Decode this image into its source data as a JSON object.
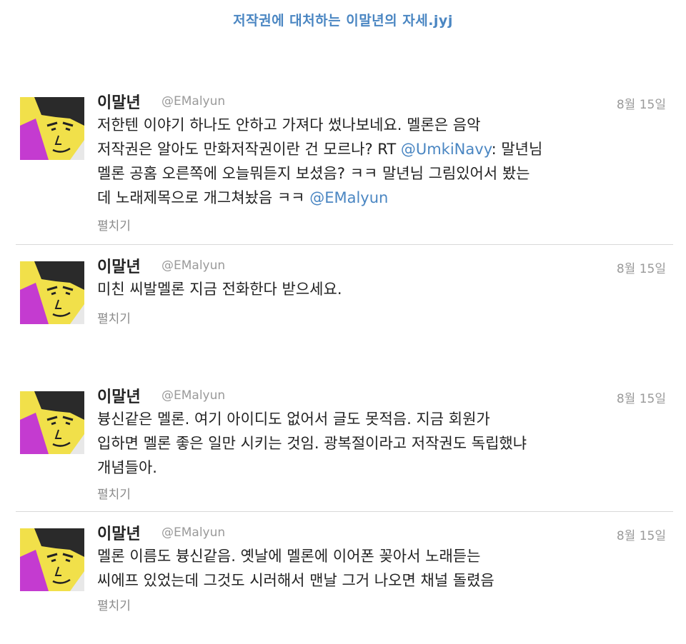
{
  "page_title": "저작권에 대처하는 이말년의 자세.jyj",
  "tweets": [
    {
      "name": "이말년",
      "handle": "@EMalyun",
      "date": "8월 15일",
      "lines": [
        "저한텐 이야기 하나도 안하고 가져다 썼나보네요. 멜론은 음악",
        "저작권은 알아도 만화저작권이란 건 모르나? RT ",
        "@UmkiNavy",
        ": 말년님",
        "멜론 공홈 오른쪽에 오늘뭐듣지 보셨음? ㅋㅋ 말년님 그림있어서 봤는",
        "데 노래제목으로 개그쳐놨음 ㅋㅋ ",
        "@EMalyun"
      ],
      "expand": "펼치기"
    },
    {
      "name": "이말년",
      "handle": "@EMalyun",
      "date": "8월 15일",
      "lines": [
        "미친 씨발멜론 지금 전화한다 받으세요."
      ],
      "expand": "펼치기"
    },
    {
      "name": "이말년",
      "handle": "@EMalyun",
      "date": "8월 15일",
      "lines": [
        "븅신같은 멜론. 여기 아이디도 없어서 글도 못적음. 지금 회원가",
        "입하면 멜론 좋은 일만 시키는 것임. 광복절이라고 저작권도 독립했냐",
        "개념들아."
      ],
      "expand": "펼치기"
    },
    {
      "name": "이말년",
      "handle": "@EMalyun",
      "date": "8월 15일",
      "lines": [
        "멜론 이름도 븅신같음. 옛날에 멜론에 이어폰 꽂아서 노래듣는",
        "씨에프 있었는데 그것도 시러해서 맨날 그거 나오면 채널 돌렸음"
      ],
      "expand": "펼치기"
    }
  ],
  "colors": {
    "link": "#4a86c2",
    "meta": "#9a9a9a",
    "avatar_bg": "#f1e04a",
    "avatar_accent": "#c43bd0"
  }
}
